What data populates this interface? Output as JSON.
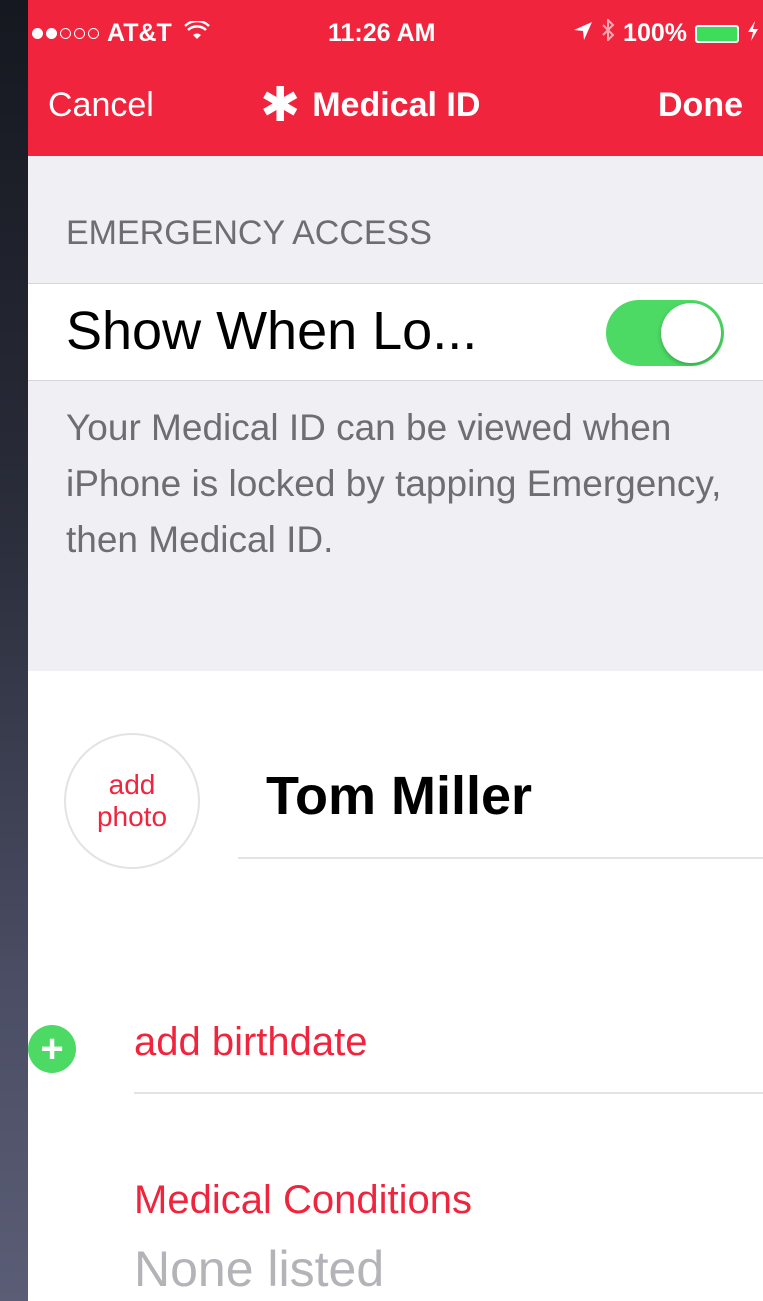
{
  "status_bar": {
    "carrier": "AT&T",
    "time": "11:26 AM",
    "battery": "100%"
  },
  "nav": {
    "cancel_label": "Cancel",
    "title": "Medical ID",
    "title_symbol": "✱",
    "done_label": "Done"
  },
  "emergency": {
    "header": "EMERGENCY ACCESS",
    "toggle_label": "Show When Lo...",
    "toggle_on": true,
    "footer": "Your Medical ID can be viewed when iPhone is locked by tapping Emergency, then Medical ID."
  },
  "profile": {
    "add_photo_line1": "add",
    "add_photo_line2": "photo",
    "name": "Tom Miller"
  },
  "birthdate": {
    "add_label": "add birthdate"
  },
  "medical_conditions": {
    "label": "Medical Conditions",
    "value": "None listed"
  },
  "colors": {
    "accent": "#f0243c",
    "toggle_green": "#4cd964",
    "grouped_bg": "#efeff4"
  }
}
